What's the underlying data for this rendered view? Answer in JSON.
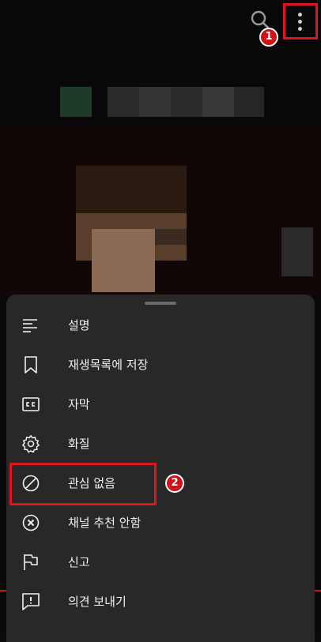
{
  "screen": {
    "video_area": "blurred-video-frame",
    "top_bar": {
      "search_icon": "search-icon",
      "more_icon": "more-vert-icon"
    },
    "step_badges": [
      "1",
      "2"
    ]
  },
  "sheet": {
    "items": [
      {
        "icon": "description-icon",
        "label": "설명"
      },
      {
        "icon": "bookmark-icon",
        "label": "재생목록에 저장"
      },
      {
        "icon": "closed-captions-icon",
        "label": "자막"
      },
      {
        "icon": "gear-icon",
        "label": "화질"
      },
      {
        "icon": "not-interested-icon",
        "label": "관심 없음"
      },
      {
        "icon": "block-channel-icon",
        "label": "채널 추천 안함"
      },
      {
        "icon": "flag-icon",
        "label": "신고"
      },
      {
        "icon": "feedback-icon",
        "label": "의견 보내기"
      }
    ]
  },
  "colors": {
    "sheet_bg": "#282828",
    "highlight": "#e0141b",
    "text": "#f1f1f1"
  }
}
